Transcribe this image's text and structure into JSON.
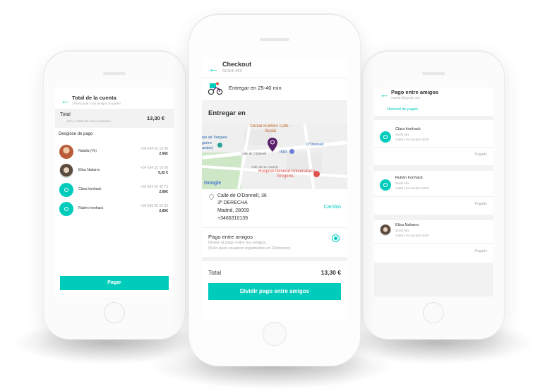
{
  "colors": {
    "accent": "#00ccbc",
    "text": "#2e3333",
    "muted": "#a8a8a8",
    "pin": "#5a1f6b",
    "hospital": "#e0524a"
  },
  "left": {
    "title": "Total de la cuenta",
    "subtitle": "¡Ahora pide a tus amigos su parte!",
    "total_label": "Total",
    "total_note": "IVA y costes de envío incluidos",
    "total_value": "13,30 €",
    "breakdown_label": "Desglose de pago",
    "people": [
      {
        "name": "Natalia (Yo)",
        "phone": "+34 654 32 10 99",
        "amount": "2,66€",
        "avatar": "photo-female-icon"
      },
      {
        "name": "Elisa Naharro",
        "phone": "+34 654 32 10 99",
        "amount": "5,32 €",
        "avatar": "photo-female-2-icon"
      },
      {
        "name": "Clara Ironhack",
        "phone": "+34 634 20 42 73",
        "amount": "2,66€",
        "avatar": "user-icon"
      },
      {
        "name": "Rubén Ironhack",
        "phone": "+34 666 65 10 93",
        "amount": "2,66€",
        "avatar": "user-icon"
      }
    ],
    "pay_button": "Pagar"
  },
  "center": {
    "title": "Checkout",
    "subtitle": "SUSHI MIX",
    "delivery_time": "Entregar en 25-40 min",
    "deliver_heading": "Entregar en",
    "map": {
      "labels": {
        "cafe": "Cereal Hunters Café - Alcalá",
        "vergara": "ipe de Vergara",
        "aguirre": "guirre arabe)",
        "odonnell_station": "O'Donnell",
        "street": "Calle de O'Donnell",
        "ing": "ING",
        "callejon": "Calle del Dr. Castelo",
        "hospital": "Hospital General Universitario Gregorio...",
        "google": "Google"
      }
    },
    "address": {
      "line1": "Calle de O'Donnell, 36",
      "line2": "3ª DERECHA",
      "line3": "Madrid, 28009",
      "line4": "+3466310139",
      "change": "Cambio"
    },
    "split_option": {
      "title": "Pago entre amigos",
      "desc1": "Divide el pago entre tus amigos.",
      "desc2": "(Solo para usuarios registrados en Deliveroo)"
    },
    "total_label": "Total",
    "total_value": "13,30 €",
    "split_button": "Dividir pago entre amigos"
  },
  "right": {
    "title": "Pago entre amigos",
    "email": "natalia7@gmail.com",
    "history_link": "Historial de pagos",
    "payments": [
      {
        "name": "Clara Ironhack",
        "restaurant": "Sushi Mix",
        "detail": "2,66€ | 04 octubre 2020",
        "status": "Pagado",
        "avatar": "user-icon"
      },
      {
        "name": "Rubén Ironhack",
        "restaurant": "Sushi Mix",
        "detail": "2,66€ | 04 octubre 2020",
        "status": "Pagado",
        "avatar": "user-icon"
      },
      {
        "name": "Elisa Naharro",
        "restaurant": "Sushi Mix",
        "detail": "2,66€ | 04 octubre 2020",
        "status": "Pagado",
        "avatar": "photo-female-2-icon"
      }
    ]
  }
}
